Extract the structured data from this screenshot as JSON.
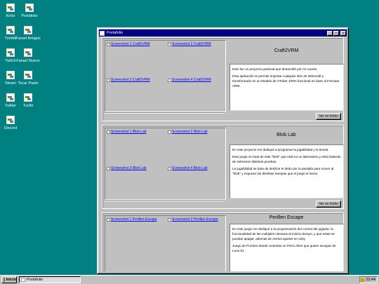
{
  "desktop": {
    "icons": [
      {
        "label": "Itchio",
        "icon": "itchio-shortcut-icon"
      },
      {
        "label": "Portafolio",
        "icon": "portafolio-shortcut-icon"
      },
      {
        "label": "Tumblr",
        "icon": "tumblr-shortcut-icon"
      },
      {
        "label": "Fanart Amigos",
        "icon": "fanart-amigos-icon"
      },
      {
        "label": "Twitch",
        "icon": "twitch-shortcut-icon"
      },
      {
        "label": "Fanart Nuevo",
        "icon": "fanart-nuevo-icon"
      },
      {
        "label": "Steam",
        "icon": "steam-shortcut-icon"
      },
      {
        "label": "Tocar Pasto",
        "icon": "tocar-pasto-icon"
      },
      {
        "label": "Twitter",
        "icon": "twitter-shortcut-icon"
      },
      {
        "label": "Tuvito",
        "icon": "tuvito-shortcut-icon"
      },
      {
        "label": "Discord",
        "icon": "discord-shortcut-icon"
      }
    ]
  },
  "window": {
    "title": "Portafolio",
    "minimize": "_",
    "maximize": "□",
    "close": "×"
  },
  "projects": [
    {
      "title": "Craft2VRM",
      "shots": [
        "Screenshot 1 Craft2VRM",
        "Screenshot 2 Craft2VRM",
        "Screenshot 3 Craft2VRM",
        "Screenshot 4 Craft2VRM"
      ],
      "desc": [
        "Este fue un proyecto pasional que desarrollé por mi cuenta.",
        "Esta aplicación te permite importar cualquier skin de Minecraft y transformarlo en un Modelo de VTuber 100% funcional en base al Formato VRM."
      ],
      "button": "Ver en Itchio"
    },
    {
      "title": "Blob Lab",
      "shots": [
        "Screenshot 1 Blob Lab",
        "Screenshot 2 Blob Lab",
        "Screenshot 3 Blob Lab",
        "Screenshot 4 Blob Lab"
      ],
      "desc": [
        "En este proyecto me dediqué a programar la jugabilidad y la tienda.",
        "Este juego se trata de este \"blob\" que está en un laboratorio y está tratando de sobrevivir distintas pruebas.",
        "La jugabilidad se trata de deslizar el dedo por la pantalla para mover al \"blob\" y esquivar las distintas trampas que el juego te lanza."
      ],
      "button": "Ver en Itchio"
    },
    {
      "title": "Perillen Escape",
      "shots": [
        "Screenshot 1 Perillen Escape",
        "Screenshot 2 Perillen Escape"
      ],
      "desc": [
        "En este juego me dediqué a la programación del control del jugador, la funcionalidad de las multiples cámaras al mismo tiempo, y que estas se puedan apagar, ademas de ciertos ajustes en unity",
        "Juego de Puzzles donde controlas un Perro Alien que quiere escapar de Luna 51"
      ]
    }
  ],
  "taskbar": {
    "start": "Inicio",
    "task": "Portafolio",
    "clock": "22:44"
  }
}
